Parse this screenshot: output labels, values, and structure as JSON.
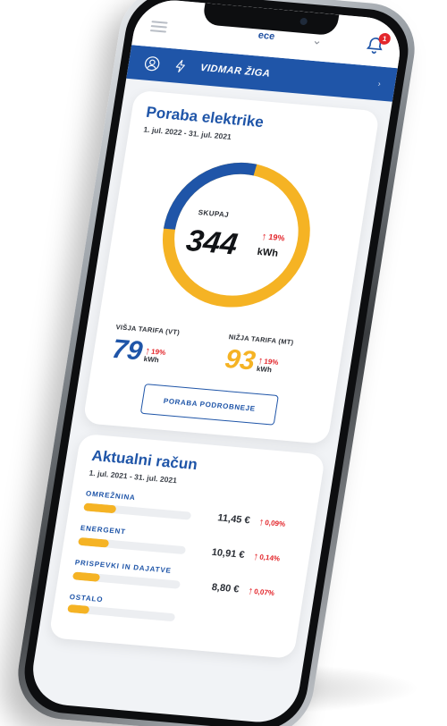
{
  "topbar": {
    "logo_text": "ece",
    "notifications": "1"
  },
  "userbar": {
    "name": "VIDMAR ŽIGA"
  },
  "consumption": {
    "title": "Poraba elektrike",
    "date_range": "1. jul. 2022 - 31. jul. 2021",
    "total_label": "SKUPAJ",
    "total_value": "344",
    "total_unit": "kWh",
    "total_change": "19%",
    "vt_share": 0.27,
    "tariffs": {
      "vt": {
        "label": "VIŠJA TARIFA (VT)",
        "value": "79",
        "unit": "kWh",
        "change": "19%"
      },
      "mt": {
        "label": "NIŽJA TARIFA (MT)",
        "value": "93",
        "unit": "kWh",
        "change": "19%"
      }
    },
    "detail_button": "PORABA PODROBNEJE"
  },
  "bill": {
    "title": "Aktualni račun",
    "date_range": "1. jul. 2021 - 31. jul. 2021",
    "items": [
      {
        "label": "OMREŽNINA",
        "amount": "11,45 €",
        "change": "0,09%",
        "fill": 0.3,
        "trend": "up"
      },
      {
        "label": "ENERGENT",
        "amount": "10,91 €",
        "change": "0,14%",
        "fill": 0.28,
        "trend": "up"
      },
      {
        "label": "PRISPEVKI IN DAJATVE",
        "amount": "8,80 €",
        "change": "0,07%",
        "fill": 0.25,
        "trend": "up"
      },
      {
        "label": "OSTALO",
        "amount": "",
        "change": "",
        "fill": 0.2,
        "trend": "down"
      }
    ]
  },
  "colors": {
    "brand_blue": "#1f55a8",
    "accent_yellow": "#f5b324",
    "increase_red": "#e3262b"
  },
  "icons": {
    "menu": "hamburger-icon",
    "bell": "bell-icon",
    "user": "user-icon",
    "lightning": "lightning-icon",
    "arrow": "arrow-up-icon"
  }
}
